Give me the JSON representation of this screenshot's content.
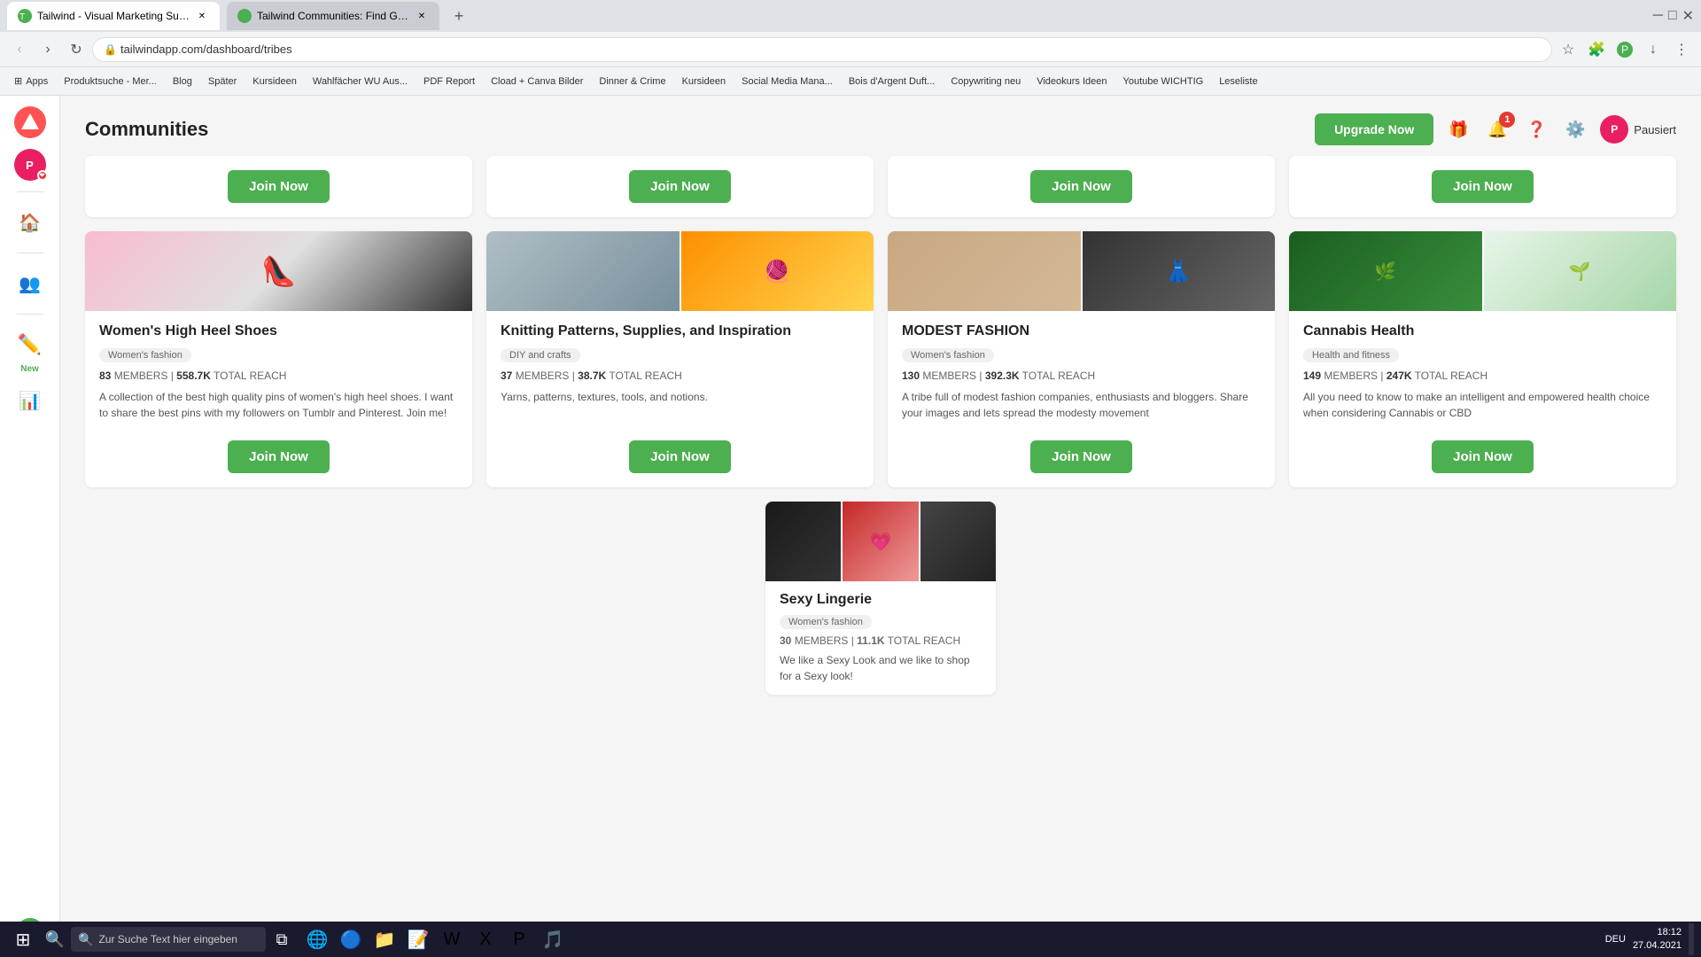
{
  "browser": {
    "tabs": [
      {
        "id": "tab1",
        "title": "Tailwind - Visual Marketing Suite: ...",
        "active": true,
        "favicon": "T"
      },
      {
        "id": "tab2",
        "title": "Tailwind Communities: Find Gre...",
        "active": false,
        "favicon": "T"
      }
    ],
    "address": "tailwindapp.com/dashboard/tribes",
    "bookmarks": [
      {
        "label": "Apps"
      },
      {
        "label": "Produktsuche - Mer..."
      },
      {
        "label": "Blog"
      },
      {
        "label": "Später"
      },
      {
        "label": "Kursideen"
      },
      {
        "label": "Wahlfächer WU Aus..."
      },
      {
        "label": "PDF Report"
      },
      {
        "label": "Cload + Canva Bilder"
      },
      {
        "label": "Dinner & Crime"
      },
      {
        "label": "Kursideen"
      },
      {
        "label": "Social Media Mana..."
      },
      {
        "label": "Bois d'Argent Duft..."
      },
      {
        "label": "Copywriting neu"
      },
      {
        "label": "Videokurs Ideen"
      },
      {
        "label": "Youtube WICHTIG"
      },
      {
        "label": "Leseliste"
      }
    ]
  },
  "page": {
    "title": "Communities",
    "upgrade_btn": "Upgrade Now"
  },
  "sidebar": {
    "items": [
      {
        "id": "home",
        "icon": "🏠",
        "label": "Home"
      },
      {
        "id": "people",
        "icon": "👥",
        "label": "People"
      },
      {
        "id": "new",
        "icon": "✏️",
        "label": "New"
      },
      {
        "id": "analytics",
        "icon": "📊",
        "label": "Analytics"
      }
    ],
    "help_label": "?"
  },
  "top_row_buttons": [
    "Join Now",
    "Join Now",
    "Join Now",
    "Join Now"
  ],
  "cards": [
    {
      "id": "card1",
      "title": "Women's High Heel Shoes",
      "badge": "Women's fashion",
      "members": "83",
      "total_reach": "558.7K",
      "description": "A collection of the best high quality pins of women's high heel shoes. I want to share the best pins with my followers on Tumblr and Pinterest. Join me!",
      "join_btn": "Join Now",
      "images": [
        "shoes"
      ]
    },
    {
      "id": "card2",
      "title": "Knitting Patterns, Supplies, and Inspiration",
      "badge": "DIY and crafts",
      "members": "37",
      "total_reach": "38.7K",
      "description": "Yarns, patterns, textures, tools, and notions.",
      "join_btn": "Join Now",
      "images": [
        "knitting",
        "knitting2"
      ]
    },
    {
      "id": "card3",
      "title": "MODEST FASHION",
      "badge": "Women's fashion",
      "members": "130",
      "total_reach": "392.3K",
      "description": "A tribe full of modest fashion companies, enthusiasts and bloggers. Share your images and lets spread the modesty movement",
      "join_btn": "Join Now",
      "images": [
        "modest",
        "modest2"
      ]
    },
    {
      "id": "card4",
      "title": "Cannabis Health",
      "badge": "Health and fitness",
      "members": "149",
      "total_reach": "247K",
      "description": "All you need to know to make an intelligent and empowered health choice when considering Cannabis or CBD",
      "join_btn": "Join Now",
      "images": [
        "cannabis",
        "cannabis2"
      ]
    }
  ],
  "bottom_card": {
    "title": "Sexy Lingerie",
    "badge": "Women's fashion",
    "members": "30",
    "total_reach": "11.1K",
    "description": "We like a Sexy Look and we like to shop for a Sexy look!",
    "images": [
      "lingerie",
      "lingerie2",
      "lingerie3"
    ]
  },
  "taskbar": {
    "search_placeholder": "Zur Suche Text hier eingeben",
    "time": "18:12",
    "date": "27.04.2021",
    "language": "DEU"
  },
  "header": {
    "notification_count": "1",
    "user_initials": "P",
    "user_name": "Pausiert"
  }
}
